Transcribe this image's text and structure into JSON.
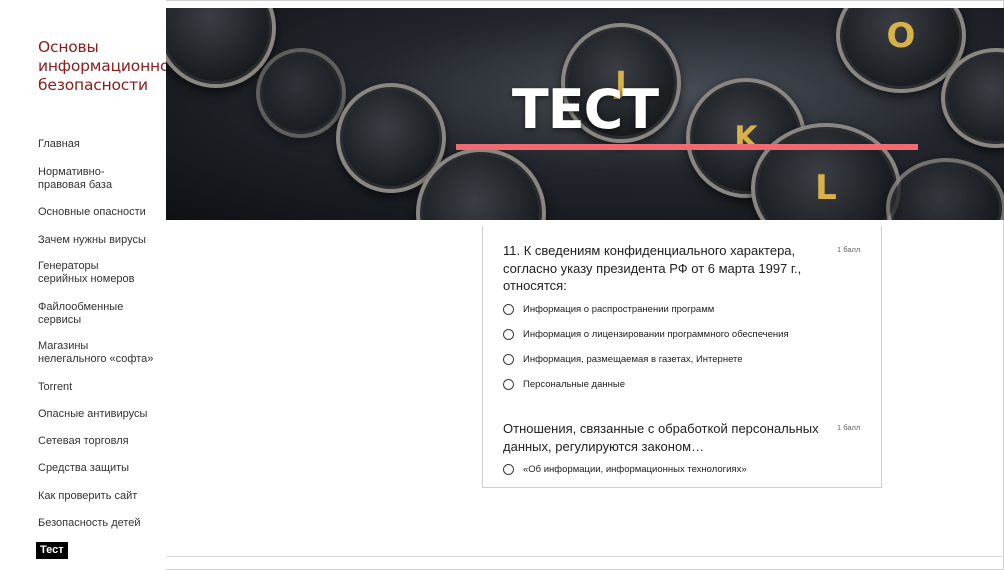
{
  "site_title": "Основы информационной безопасности",
  "nav": [
    "Главная",
    "Нормативно-правовая база",
    "Основные опасности",
    "Зачем нужны вирусы",
    "Генераторы серийных номеров",
    "Файлообменные сервисы",
    "Магазины нелегального «софта»",
    "Torrent",
    "Опасные антивирусы",
    "Сетевая торговля",
    "Средства защиты",
    "Как проверить сайт",
    "Безопасность детей",
    "Тест"
  ],
  "active_nav": "Тест",
  "banner": {
    "title": "ТЕСТ",
    "accent_color": "#ef6b73"
  },
  "questions": [
    {
      "text": "11. К сведениям конфиденциального характера, согласно указу президента РФ от 6 марта 1997 г., относятся:",
      "points": "1 балл",
      "options": [
        "Информация о распространении программ",
        "Информация о лицензировании программного обеспечения",
        "Информация, размещаемая в газетах, Интернете",
        "Персональные данные"
      ]
    },
    {
      "text": "Отношения, связанные с обработкой персональных данных, регулируются законом…",
      "points": "1 балл",
      "options": [
        "«Об информации, информационных технологиях»"
      ]
    }
  ],
  "colors": {
    "site_title": "#8b1c1c",
    "active_nav_bg": "#000000"
  }
}
